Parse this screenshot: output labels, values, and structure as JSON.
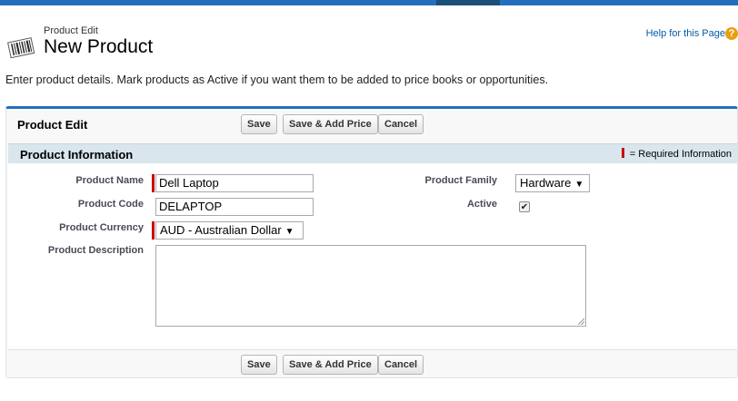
{
  "header": {
    "subtitle": "Product Edit",
    "title": "New Product",
    "help_link": "Help for this Page",
    "help_icon_glyph": "?"
  },
  "intro_text": "Enter product details. Mark products as Active if you want them to be added to price books or opportunities.",
  "panel": {
    "title": "Product Edit",
    "buttons": {
      "save": "Save",
      "save_add_price": "Save & Add Price",
      "cancel": "Cancel"
    }
  },
  "section": {
    "title": "Product Information",
    "required_legend": "= Required Information"
  },
  "fields": {
    "product_name": {
      "label": "Product Name",
      "value": "Dell Laptop",
      "required": true
    },
    "product_code": {
      "label": "Product Code",
      "value": "DELAPTOP"
    },
    "product_currency": {
      "label": "Product Currency",
      "value": "AUD - Australian Dollar",
      "required": true
    },
    "product_description": {
      "label": "Product Description",
      "value": ""
    },
    "product_family": {
      "label": "Product Family",
      "value": "Hardware"
    },
    "active": {
      "label": "Active",
      "checked": true,
      "check_glyph": "✔"
    }
  },
  "icons": {
    "product_icon": "barcode-product-icon",
    "dropdown": "chevron-down-icon",
    "dropdown_glyph": "▼"
  },
  "colors": {
    "brand_blue": "#236fbd",
    "section_header_bg": "#d9e6ed",
    "required_red": "#c00",
    "help_icon_orange": "#e8a010",
    "link_blue": "#015ba7"
  }
}
